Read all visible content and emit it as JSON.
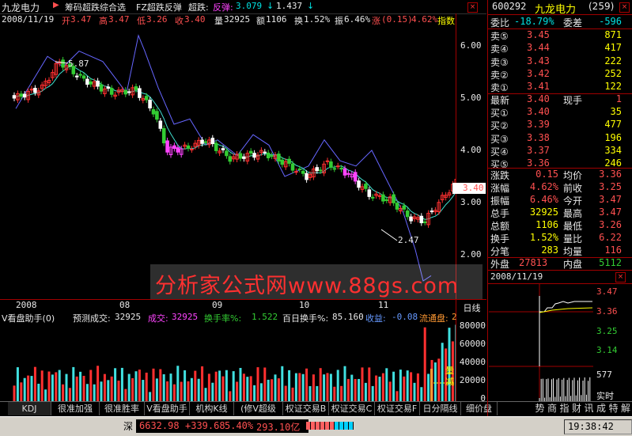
{
  "header": {
    "stock_name": "九龙电力",
    "indicators": "筹码超跌综合选",
    "formula1": "FZ超跌反弹",
    "formula2_label": "超跌:",
    "formula2_value": "反弹:",
    "v1": "3.079",
    "v2": "1.437",
    "down_arrow": "↓"
  },
  "info_line": {
    "date": "2008/11/19",
    "open_label": "开",
    "open": "3.47",
    "high_label": "高",
    "high": "3.47",
    "low_label": "低",
    "low": "3.26",
    "close_label": "收",
    "close": "3.40",
    "vol_label": "量",
    "vol": "32925",
    "amt_label": "额",
    "amt": "1106",
    "turn_label": "换",
    "turn": "1.52%",
    "amp_label": "振",
    "amp": "6.46%",
    "chg_label": "涨",
    "chg": "(0.15)",
    "pct": "4.62%",
    "tail": "指数"
  },
  "price_axis": [
    "6.00",
    "5.00",
    "4.00",
    "3.00",
    "2.00"
  ],
  "price_tag": "3.40",
  "annot_high": "5.87",
  "annot_low": "2.47",
  "watermark": "分析家公式网www.88gs.com",
  "time_axis": [
    "2008",
    "08",
    "09",
    "10",
    "11"
  ],
  "period_label": "日线",
  "vol_header": {
    "name": "V看盘助手(0)",
    "pred_label": "预测成交:",
    "pred": "32925",
    "deal_label": "成交:",
    "deal": "32925",
    "turnrate_label": "换手率%:",
    "turnrate": "1.522",
    "hundred_label": "百日换手%:",
    "hundred": "85.160",
    "shou_label": "收益:",
    "shou": "-0.08",
    "float_label": "流通盘:",
    "float": "2"
  },
  "vol_axis": [
    "80000",
    "60000",
    "40000",
    "20000",
    "0"
  ],
  "vol_side": [
    "量",
    "减"
  ],
  "tabs": [
    "KDJ",
    "很准加强",
    "很准胜率",
    "V看盘助手",
    "机构K线",
    "(修V超级MACD)",
    "权证交易B",
    "权证交易C",
    "权证交易F",
    "日分隔线",
    "细价盘"
  ],
  "right_tabs": [
    "势",
    "商",
    "指",
    "财",
    "讯",
    "成",
    "特",
    "解"
  ],
  "status": {
    "market": "深",
    "index": "6632.98",
    "change": "+339.68",
    "pct": "5.40%",
    "amount": "293.10亿",
    "time": "19:38:42"
  },
  "quote": {
    "code": "600292",
    "name": "九龙电力",
    "num": "(259)",
    "webi_label": "委比",
    "webi": "-18.79%",
    "wecha_label": "委差",
    "wecha": "-596",
    "sells": [
      {
        "label": "卖⑤",
        "price": "3.45",
        "vol": "871"
      },
      {
        "label": "卖④",
        "price": "3.44",
        "vol": "417"
      },
      {
        "label": "卖③",
        "price": "3.43",
        "vol": "222"
      },
      {
        "label": "卖②",
        "price": "3.42",
        "vol": "252"
      },
      {
        "label": "卖①",
        "price": "3.41",
        "vol": "122"
      }
    ],
    "latest_label": "最新",
    "latest": "3.40",
    "now_label": "现手",
    "now": "1",
    "buys": [
      {
        "label": "买①",
        "price": "3.40",
        "vol": "35"
      },
      {
        "label": "买②",
        "price": "3.39",
        "vol": "477"
      },
      {
        "label": "买③",
        "price": "3.38",
        "vol": "196"
      },
      {
        "label": "买④",
        "price": "3.37",
        "vol": "334"
      },
      {
        "label": "买⑤",
        "price": "3.36",
        "vol": "246"
      }
    ],
    "stats": [
      {
        "l1": "涨跌",
        "v1": "0.15",
        "l2": "均价",
        "v2": "3.36"
      },
      {
        "l1": "涨幅",
        "v1": "4.62%",
        "l2": "前收",
        "v2": "3.25"
      },
      {
        "l1": "振幅",
        "v1": "6.46%",
        "l2": "今开",
        "v2": "3.47"
      },
      {
        "l1": "总手",
        "v1": "32925",
        "l2": "最高",
        "v2": "3.47"
      },
      {
        "l1": "总额",
        "v1": "1106",
        "l2": "最低",
        "v2": "3.26"
      },
      {
        "l1": "换手",
        "v1": "1.52%",
        "l2": "量比",
        "v2": "6.22"
      },
      {
        "l1": "分笔",
        "v1": "283",
        "l2": "均量",
        "v2": "116"
      }
    ],
    "outer_label": "外盘",
    "outer": "27813",
    "inner_label": "内盘",
    "inner": "5112",
    "mini_date": "2008/11/19",
    "mini_axis": [
      "3.47",
      "3.36",
      "3.25",
      "3.14"
    ],
    "mini_vol": "577",
    "mini_time": "实时"
  }
}
